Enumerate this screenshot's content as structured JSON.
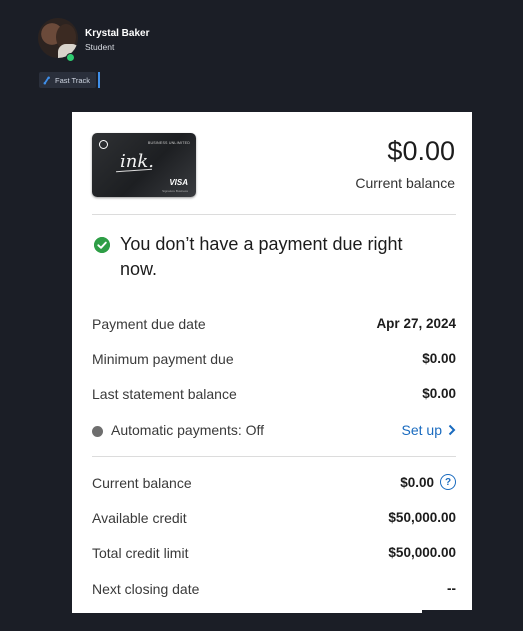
{
  "profile": {
    "name": "Krystal Baker",
    "role": "Student"
  },
  "badge": {
    "label": "Fast Track",
    "icon": "phone-icon"
  },
  "summary": {
    "balance_amount": "$0.00",
    "balance_label": "Current balance",
    "card": {
      "tier": "BUSINESS UNLIMITED",
      "script": "ink.",
      "network": "VISA",
      "network_sub": "Signature Business"
    }
  },
  "payment_status": {
    "message": "You don’t have a payment due right now.",
    "icon": "check-circle-icon"
  },
  "details": {
    "payment_due_date": {
      "label": "Payment due date",
      "value": "Apr 27, 2024"
    },
    "minimum_payment": {
      "label": "Minimum payment due",
      "value": "$0.00"
    },
    "last_statement": {
      "label": "Last statement balance",
      "value": "$0.00"
    },
    "autopay": {
      "label": "Automatic payments: Off",
      "action": "Set up"
    }
  },
  "credit": {
    "current_balance": {
      "label": "Current balance",
      "value": "$0.00"
    },
    "available_credit": {
      "label": "Available credit",
      "value": "$50,000.00"
    },
    "total_limit": {
      "label": "Total credit limit",
      "value": "$50,000.00"
    },
    "next_closing": {
      "label": "Next closing date",
      "value": "--"
    }
  },
  "colors": {
    "background": "#1b1e26",
    "link": "#1a6bbf",
    "success": "#2e9e46",
    "status_online": "#2ecc71"
  }
}
